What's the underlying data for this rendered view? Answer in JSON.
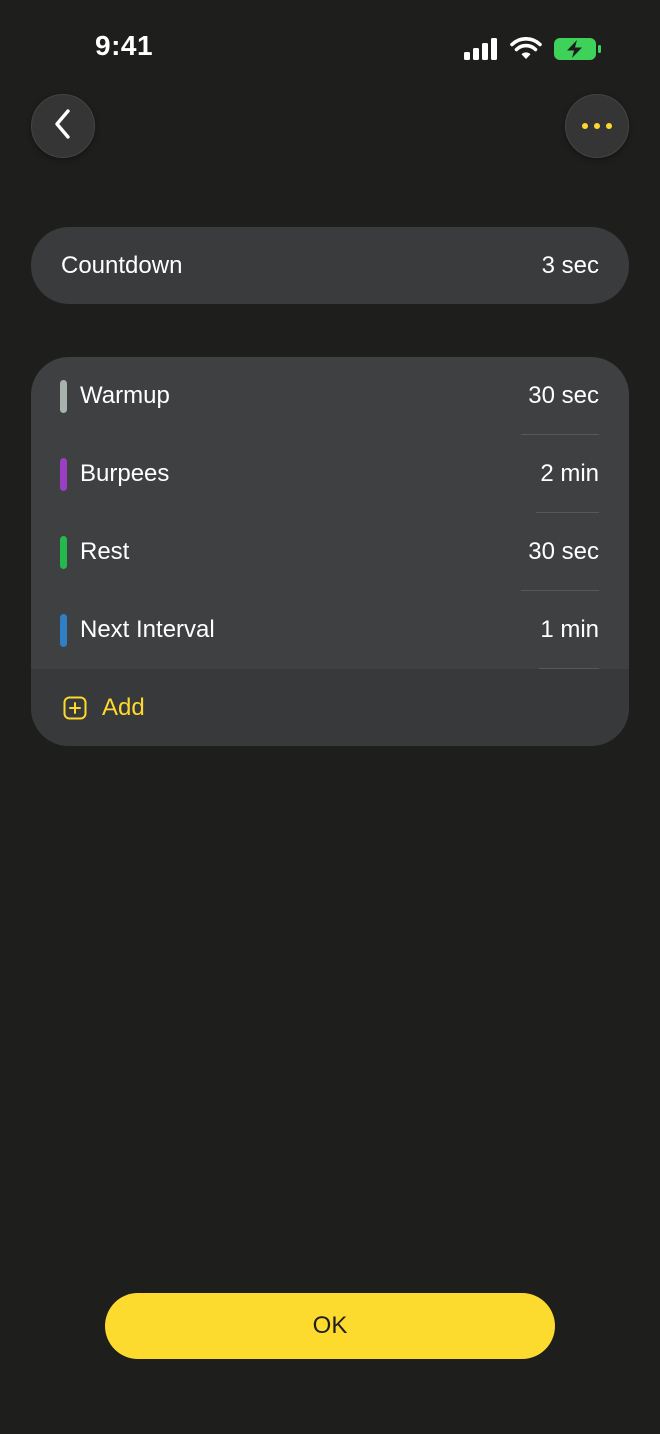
{
  "status_bar": {
    "time": "9:41",
    "icons": [
      "cellular-signal-icon",
      "wifi-icon",
      "battery-charging-icon"
    ],
    "battery_color": "#3fd25a"
  },
  "nav": {
    "back_icon": "chevron-left-icon",
    "more_icon": "ellipsis-icon",
    "accent": "#fdd92e"
  },
  "countdown": {
    "label": "Countdown",
    "value": "3 sec"
  },
  "intervals": [
    {
      "name": "Warmup",
      "duration": "30 sec",
      "color": "#a9b3ae"
    },
    {
      "name": "Burpees",
      "duration": "2 min",
      "color": "#9a3fc1"
    },
    {
      "name": "Rest",
      "duration": "30 sec",
      "color": "#25b84c"
    },
    {
      "name": "Next Interval",
      "duration": "1 min",
      "color": "#2f7fc4"
    }
  ],
  "add": {
    "icon": "plus-square-icon",
    "label": "Add"
  },
  "ok_button": {
    "label": "OK",
    "color": "#fdda2e"
  }
}
